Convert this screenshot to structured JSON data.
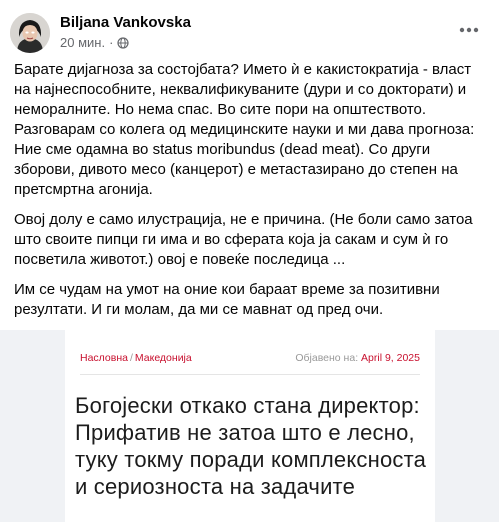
{
  "post": {
    "author": "Biljana Vankovska",
    "time": "20 мин.",
    "dot": "·",
    "privacy_icon": "globe-icon",
    "more_icon": "more-horizontal-icon",
    "paragraphs": [
      "Барате дијагноза за состојбата? Името ѝ е какистократија - власт на најнеспособните, неквалификуваните (дури и со докторати) и неморалните. Но нема спас. Во сите пори на општеството. Разговарам со колега од медицинските науки и ми дава прогноза: Ние сме одамна во status moribundus (dead meat). Со други зборови, дивото месо (канцерот) е метастазирано до степен на претсмртна агонија.",
      "Овој долу е само илустрација, не е причина. (Не боли само затоа што своите пипци ги има и во сферата која ја сакам и сум ѝ го посветила животот.) овој е повеќе последица ...",
      "Им се чудам на умот на оние кои бараат време за позитивни резултати. И ги молам, да ми се мавнат од пред очи."
    ]
  },
  "link_preview": {
    "breadcrumb": [
      "Насловна",
      "Македонија"
    ],
    "breadcrumb_separator": "/",
    "published_label": "Објавено на:",
    "published_date": "April 9, 2025",
    "headline": "Богојески откако стана директор: Прифатив не затоа што е лесно, туку токму поради комплексноста и сериозноста на задачите"
  },
  "colors": {
    "accent_red": "#c8102e",
    "secondary_text": "#65676b",
    "preview_background": "#f0f2f5"
  }
}
